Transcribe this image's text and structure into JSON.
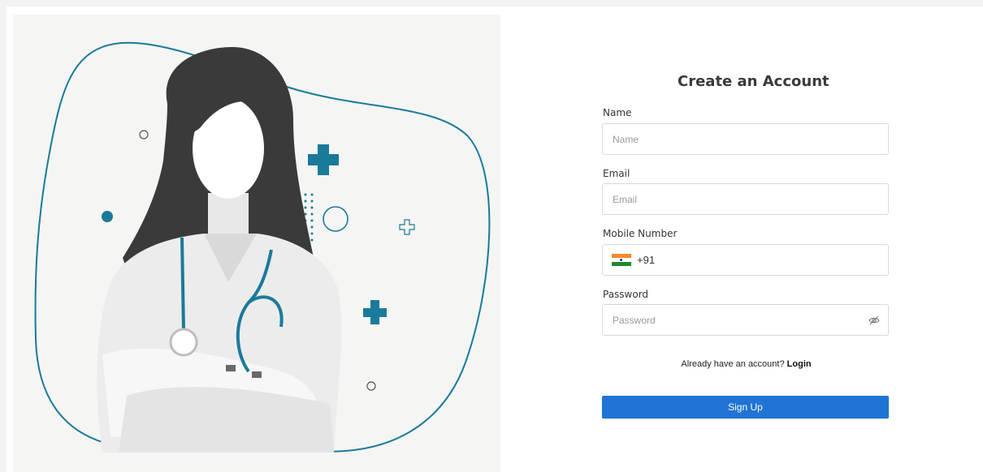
{
  "form": {
    "title": "Create an Account",
    "name": {
      "label": "Name",
      "placeholder": "Name"
    },
    "email": {
      "label": "Email",
      "placeholder": "Email"
    },
    "mobile": {
      "label": "Mobile Number",
      "dial_code": "+91",
      "country_flag": "india-flag-icon"
    },
    "password": {
      "label": "Password",
      "placeholder": "Password",
      "toggle_icon": "eye-slash-icon"
    },
    "login_prompt": "Already have an account?",
    "login_link": "Login",
    "submit_label": "Sign Up"
  },
  "colors": {
    "accent": "#1f74d4",
    "illustration_teal": "#1a7a9a",
    "panel_bg": "#f5f5f4"
  }
}
